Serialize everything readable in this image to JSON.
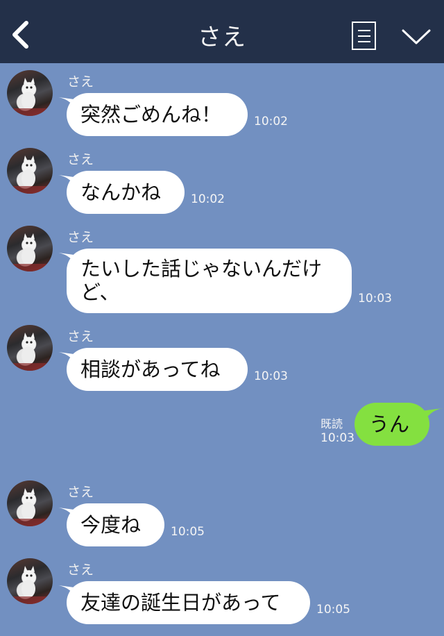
{
  "header": {
    "title": "さえ"
  },
  "messages": [
    {
      "sender": "さえ",
      "text": "突然ごめんね！",
      "time": "10:02"
    },
    {
      "sender": "さえ",
      "text": "なんかね",
      "time": "10:02"
    },
    {
      "sender": "さえ",
      "text": "たいした話じゃないんだけど、",
      "time": "10:03"
    },
    {
      "sender": "さえ",
      "text": "相談があってね",
      "time": "10:03"
    },
    {
      "sender": "me",
      "text": "うん",
      "time": "10:03",
      "read_label": "既読"
    },
    {
      "sender": "さえ",
      "text": "今度ね",
      "time": "10:05"
    },
    {
      "sender": "さえ",
      "text": "友達の誕生日があって",
      "time": "10:05"
    }
  ],
  "colors": {
    "header_bg": "#233049",
    "chat_bg": "#7290c1",
    "incoming_bubble": "#ffffff",
    "outgoing_bubble": "#84e040"
  },
  "icons": [
    "back-chevron-icon",
    "menu-list-icon",
    "chevron-down-icon",
    "avatar-cat-photo"
  ]
}
